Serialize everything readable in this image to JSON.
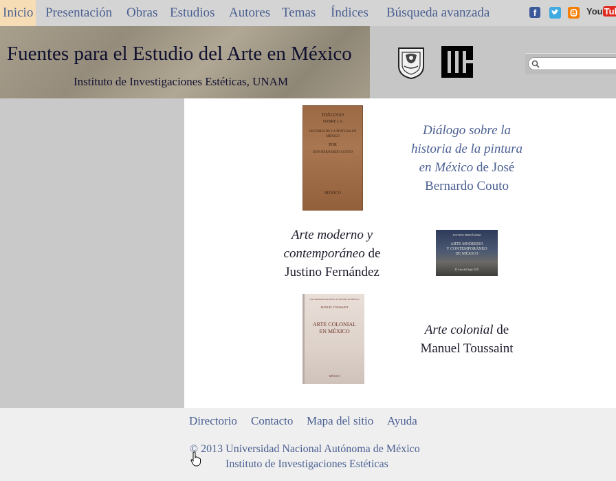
{
  "nav": {
    "items": [
      {
        "label": "Inicio",
        "active": true
      },
      {
        "label": "Presentación"
      },
      {
        "label": "Obras"
      },
      {
        "label": "Estudios"
      },
      {
        "label": "Autores"
      },
      {
        "label": "Temas"
      },
      {
        "label": "Índices"
      },
      {
        "label": "Búsqueda avanzada"
      }
    ],
    "social": [
      "facebook-icon",
      "twitter-icon",
      "blogger-icon",
      "youtube-icon"
    ],
    "youtube_label_a": "You",
    "youtube_label_b": "Tube",
    "facebook_glyph": "f"
  },
  "header": {
    "title": "Fuentes para el Estudio del Arte en México",
    "subtitle": "Instituto de Investigaciones Estéticas, UNAM",
    "search": {
      "value": "",
      "placeholder": ""
    }
  },
  "books": [
    {
      "title": "Diálogo sobre la historia de la pintura en México",
      "connector": " de ",
      "author": "José Bernardo Couto",
      "cover_lines": [
        "DIÁLOGO",
        "SOBRE LA",
        "HISTORIA DE LA PINTURA EN MÉXICO",
        "POR",
        "DON BERNARDO COUTO",
        "MÉXICO"
      ]
    },
    {
      "title": "Arte moderno y contemporáneo",
      "connector": " de ",
      "author": "Justino Fernández",
      "cover_lines": [
        "JUSTINO FERNÁNDEZ",
        "ARTE MODERNO",
        "Y CONTEMPORÁNEO",
        "DE MÉXICO",
        "El Arte del Siglo XIX"
      ]
    },
    {
      "title": "Arte colonial",
      "connector": " de ",
      "author": "Manuel Toussaint",
      "cover_lines": [
        "UNIVERSIDAD NACIONAL AUTÓNOMA DE MÉXICO",
        "MANUEL TOUSSAINT",
        "ARTE COLONIAL",
        "EN MÉXICO",
        "MÉXICO"
      ]
    }
  ],
  "footer": {
    "links": [
      "Directorio",
      "Contacto",
      "Mapa del sitio",
      "Ayuda"
    ],
    "copyright": "© 2013 Universidad Nacional Autónoma de México",
    "institute": "Instituto de Investigaciones Estéticas"
  },
  "colors": {
    "link": "#4a5f91",
    "active_tab_bg": "#f6ddb6",
    "nav_bg": "#d4d4d4",
    "footer_bg": "#efefef"
  }
}
